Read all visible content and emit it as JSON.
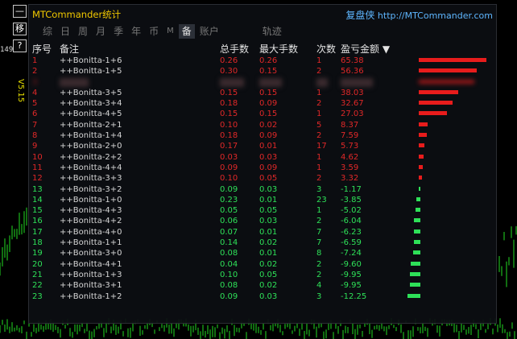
{
  "app": {
    "title": "MTCommander统计",
    "brand_cn": "复盘侠",
    "brand_url": "http://MTCommander.com"
  },
  "sidebar": {
    "buttons": [
      {
        "label": "—",
        "name": "minimize-button"
      },
      {
        "label": "移",
        "name": "move-button"
      },
      {
        "label": "?",
        "name": "help-button"
      },
      {
        "label": "✕",
        "name": "close-button"
      }
    ],
    "price_label": "149",
    "version": "V5.15"
  },
  "tabs": [
    {
      "label": "综",
      "name": "tab-summary"
    },
    {
      "label": "日",
      "name": "tab-day"
    },
    {
      "label": "周",
      "name": "tab-week"
    },
    {
      "label": "月",
      "name": "tab-month"
    },
    {
      "label": "季",
      "name": "tab-quarter"
    },
    {
      "label": "年",
      "name": "tab-year"
    },
    {
      "label": "币",
      "name": "tab-currency"
    },
    {
      "label": "M",
      "name": "tab-magic"
    },
    {
      "label": "备",
      "name": "tab-comment",
      "active": true
    },
    {
      "label": "账户",
      "name": "tab-account"
    },
    {
      "label": "轨迹",
      "name": "tab-track"
    }
  ],
  "table": {
    "headers": {
      "index": "序号",
      "note": "备注",
      "total_lots": "总手数",
      "max_lots": "最大手数",
      "count": "次数",
      "profit": "盈亏金额 ▼"
    },
    "rows": [
      {
        "index": "1",
        "note": "++Bonitta-1+6",
        "total": "0.26",
        "max": "0.26",
        "count": "1",
        "profit": "65.38",
        "value": 65.38
      },
      {
        "index": "2",
        "note": "++Bonitta-1+5",
        "total": "0.30",
        "max": "0.15",
        "count": "2",
        "profit": "56.36",
        "value": 56.36
      },
      {
        "index": "3",
        "note": "",
        "total": "",
        "max": "",
        "count": "",
        "profit": "",
        "value": 54,
        "blurred": true
      },
      {
        "index": "4",
        "note": "++Bonitta-3+5",
        "total": "0.15",
        "max": "0.15",
        "count": "1",
        "profit": "38.03",
        "value": 38.03
      },
      {
        "index": "5",
        "note": "++Bonitta-3+4",
        "total": "0.18",
        "max": "0.09",
        "count": "2",
        "profit": "32.67",
        "value": 32.67
      },
      {
        "index": "6",
        "note": "++Bonitta-4+5",
        "total": "0.15",
        "max": "0.15",
        "count": "1",
        "profit": "27.03",
        "value": 27.03
      },
      {
        "index": "7",
        "note": "++Bonitta-2+1",
        "total": "0.10",
        "max": "0.02",
        "count": "5",
        "profit": "8.37",
        "value": 8.37
      },
      {
        "index": "8",
        "note": "++Bonitta-1+4",
        "total": "0.18",
        "max": "0.09",
        "count": "2",
        "profit": "7.59",
        "value": 7.59
      },
      {
        "index": "9",
        "note": "++Bonitta-2+0",
        "total": "0.17",
        "max": "0.01",
        "count": "17",
        "profit": "5.73",
        "value": 5.73
      },
      {
        "index": "10",
        "note": "++Bonitta-2+2",
        "total": "0.03",
        "max": "0.03",
        "count": "1",
        "profit": "4.62",
        "value": 4.62
      },
      {
        "index": "11",
        "note": "++Bonitta-4+4",
        "total": "0.09",
        "max": "0.09",
        "count": "1",
        "profit": "3.59",
        "value": 3.59
      },
      {
        "index": "12",
        "note": "++Bonitta-3+3",
        "total": "0.10",
        "max": "0.05",
        "count": "2",
        "profit": "3.32",
        "value": 3.32
      },
      {
        "index": "13",
        "note": "++Bonitta-3+2",
        "total": "0.09",
        "max": "0.03",
        "count": "3",
        "profit": "-1.17",
        "value": -1.17
      },
      {
        "index": "14",
        "note": "++Bonitta-1+0",
        "total": "0.23",
        "max": "0.01",
        "count": "23",
        "profit": "-3.85",
        "value": -3.85
      },
      {
        "index": "15",
        "note": "++Bonitta-4+3",
        "total": "0.05",
        "max": "0.05",
        "count": "1",
        "profit": "-5.02",
        "value": -5.02
      },
      {
        "index": "16",
        "note": "++Bonitta-4+2",
        "total": "0.06",
        "max": "0.03",
        "count": "2",
        "profit": "-6.04",
        "value": -6.04
      },
      {
        "index": "17",
        "note": "++Bonitta-4+0",
        "total": "0.07",
        "max": "0.01",
        "count": "7",
        "profit": "-6.23",
        "value": -6.23
      },
      {
        "index": "18",
        "note": "++Bonitta-1+1",
        "total": "0.14",
        "max": "0.02",
        "count": "7",
        "profit": "-6.59",
        "value": -6.59
      },
      {
        "index": "19",
        "note": "++Bonitta-3+0",
        "total": "0.08",
        "max": "0.01",
        "count": "8",
        "profit": "-7.24",
        "value": -7.24
      },
      {
        "index": "20",
        "note": "++Bonitta-4+1",
        "total": "0.04",
        "max": "0.02",
        "count": "2",
        "profit": "-9.60",
        "value": -9.6
      },
      {
        "index": "21",
        "note": "++Bonitta-1+3",
        "total": "0.10",
        "max": "0.05",
        "count": "2",
        "profit": "-9.95",
        "value": -9.95
      },
      {
        "index": "22",
        "note": "++Bonitta-3+1",
        "total": "0.08",
        "max": "0.02",
        "count": "4",
        "profit": "-9.95",
        "value": -9.95
      },
      {
        "index": "23",
        "note": "++Bonitta-1+2",
        "total": "0.09",
        "max": "0.03",
        "count": "3",
        "profit": "-12.25",
        "value": -12.25
      }
    ]
  },
  "colors": {
    "profit": "#e02828",
    "loss": "#2ee058",
    "title": "#f0c800",
    "brand": "#5eb6ff",
    "candle": "#22dd22"
  }
}
